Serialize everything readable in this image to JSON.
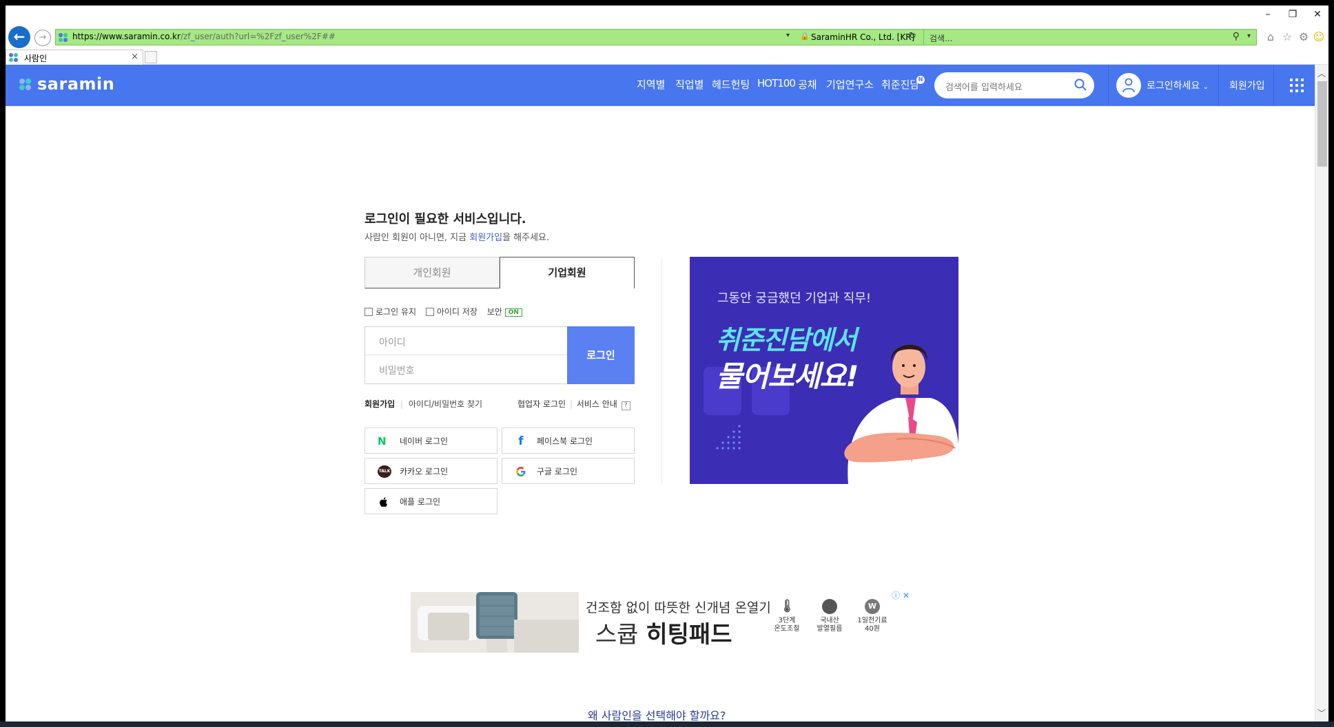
{
  "browser": {
    "url_host": "https://www.saramin.co.kr",
    "url_path": "/zf_user/auth?url=%2Fzf_user%2F##",
    "cert_label": "SaraminHR Co., Ltd. [KR]",
    "search_placeholder": "검색...",
    "tab_title": "사람인"
  },
  "header": {
    "logo_text": "saramin",
    "nav": [
      "지역별",
      "직업별",
      "헤드헌팅",
      "HOT100",
      "공채",
      "기업연구소",
      "취준진담"
    ],
    "new_badge": "N",
    "search_placeholder": "검색어를 입력하세요",
    "login_prompt": "로그인하세요",
    "signup": "회원가입"
  },
  "login": {
    "title": "로그인이 필요한 서비스입니다.",
    "subtitle_pre": "사람인 회원이 아니면, 지금 ",
    "subtitle_link": "회원가입",
    "subtitle_post": "을 해주세요.",
    "tab_personal": "개인회원",
    "tab_company": "기업회원",
    "opt_keep": "로그인 유지",
    "opt_save_id": "아이디 저장",
    "opt_security": "보안",
    "security_state": "ON",
    "id_placeholder": "아이디",
    "pw_placeholder": "비밀번호",
    "login_button": "로그인",
    "link_join": "회원가입",
    "link_find": "아이디/비밀번호 찾기",
    "link_partner": "협업자 로그인",
    "link_service": "서비스 안내",
    "help": "?",
    "social": {
      "naver": "네이버 로그인",
      "facebook": "페이스북 로그인",
      "kakao": "카카오 로그인",
      "google": "구글 로그인",
      "apple": "애플 로그인"
    }
  },
  "promo": {
    "line1": "그동안 궁금했던 기업과 직무!",
    "line2": "취준진담에서",
    "line3": "물어보세요!"
  },
  "ad": {
    "headline": "건조함 없이 따뜻한 신개념 온열기",
    "brand_pre": "스큡 ",
    "brand_bold": "히팅패드",
    "features": [
      {
        "icon": "thermometer-icon",
        "l1": "3단계",
        "l2": "온도조절"
      },
      {
        "icon": "korea-flag-icon",
        "l1": "국내산",
        "l2": "발열필름"
      },
      {
        "icon": "watt-icon",
        "l1": "1일전기료",
        "l2": "40원"
      }
    ],
    "watt_symbol": "W"
  },
  "footer": {
    "why": "왜 사람인을 선택해야 할까요?"
  },
  "colors": {
    "brand_blue": "#4876ef",
    "login_button": "#5a80f2",
    "promo_bg": "#3c2db5",
    "promo_cyan": "#5de3ee"
  }
}
